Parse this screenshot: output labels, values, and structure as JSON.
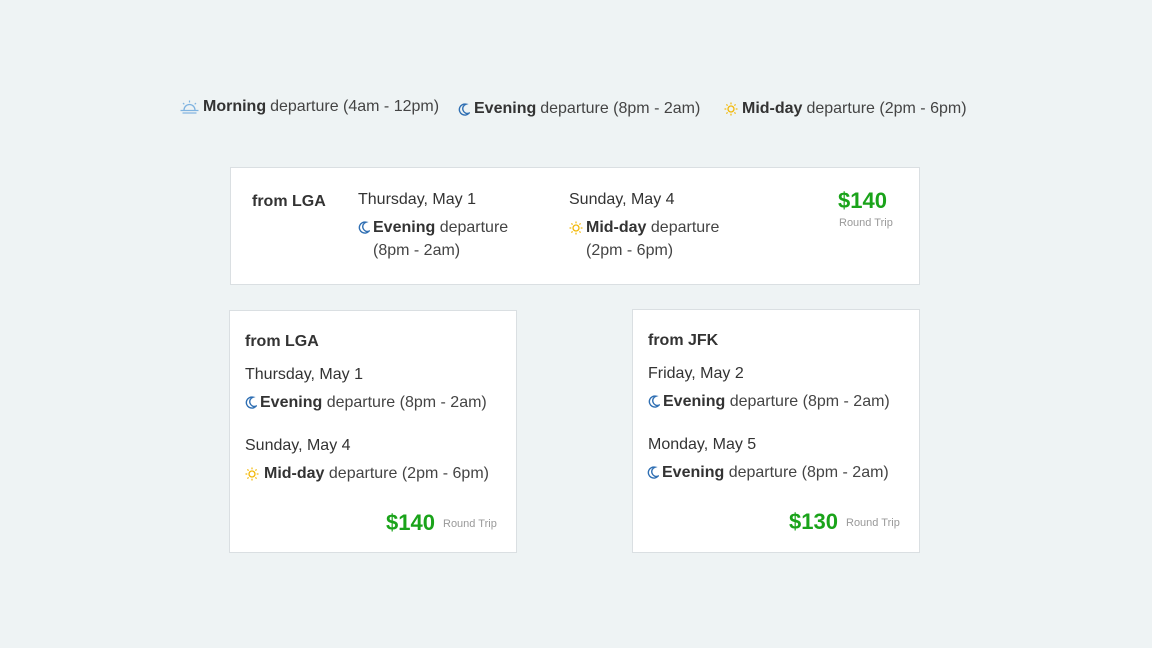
{
  "legend": {
    "morning": {
      "label": "Morning",
      "rest": "departure (4am - 12pm)",
      "icon": "sunrise-icon"
    },
    "evening": {
      "label": "Evening",
      "rest": "departure (8pm - 2am)",
      "icon": "moon-icon"
    },
    "midday": {
      "label": "Mid-day",
      "rest": "departure (2pm - 6pm)",
      "icon": "sun-icon"
    }
  },
  "colors": {
    "price": "#1aa31a",
    "moon": "#2f6fb3",
    "sun": "#f2b705",
    "sunrise": "#7fb3e0"
  },
  "wide_card": {
    "from": "from LGA",
    "outbound": {
      "date": "Thursday, May 1",
      "slot_label": "Evening",
      "slot_rest_line1": "departure",
      "slot_rest_line2": "(8pm - 2am)"
    },
    "return": {
      "date": "Sunday, May 4",
      "slot_label": "Mid-day",
      "slot_rest_line1": "departure",
      "slot_rest_line2": "(2pm - 6pm)"
    },
    "price": "$140",
    "price_note": "Round Trip"
  },
  "left_card": {
    "from": "from LGA",
    "outbound": {
      "date": "Thursday, May 1",
      "slot_label": "Evening",
      "slot_rest": "departure (8pm - 2am)"
    },
    "return": {
      "date": "Sunday, May 4",
      "slot_label": "Mid-day",
      "slot_rest": "departure (2pm - 6pm)"
    },
    "price": "$140",
    "price_note": "Round Trip"
  },
  "right_card": {
    "from": "from JFK",
    "outbound": {
      "date": "Friday, May 2",
      "slot_label": "Evening",
      "slot_rest": "departure (8pm - 2am)"
    },
    "return": {
      "date": "Monday, May 5",
      "slot_label": "Evening",
      "slot_rest": "departure (8pm - 2am)"
    },
    "price": "$130",
    "price_note": "Round Trip"
  }
}
